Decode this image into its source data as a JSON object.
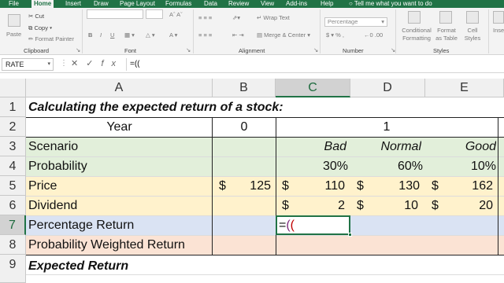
{
  "ribbon_tabs": [
    "File",
    "Home",
    "Insert",
    "Draw",
    "Page Layout",
    "Formulas",
    "Data",
    "Review",
    "View",
    "Add-ins",
    "Help"
  ],
  "active_tab": "Home",
  "tell_me": "Tell me what you want to do",
  "ribbon": {
    "paste": "Paste",
    "cut": "Cut",
    "copy": "Copy",
    "format_painter": "Format Painter",
    "clipboard": "Clipboard",
    "bold": "B",
    "italic": "I",
    "underline": "U",
    "font": "Font",
    "wrap_text": "Wrap Text",
    "merge_center": "Merge & Center",
    "alignment": "Alignment",
    "number_format": "Percentage",
    "number": "Number",
    "conditional_formatting": "Conditional Formatting",
    "format_as_table": "Format as Table",
    "cell_styles": "Cell Styles",
    "styles": "Styles",
    "insert": "Inse"
  },
  "formula_bar": {
    "name_box": "RATE",
    "cancel": "✕",
    "enter": "✓",
    "fx": "fx",
    "formula": "=(("
  },
  "columns": [
    "A",
    "B",
    "C",
    "D",
    "E"
  ],
  "selected_column": "C",
  "rows": [
    "1",
    "2",
    "3",
    "4",
    "5",
    "6",
    "7",
    "8",
    "9"
  ],
  "selected_row": "7",
  "sheet": {
    "title": "Calculating the expected return of a stock:",
    "year_label": "Year",
    "year_0": "0",
    "year_1": "1",
    "scenario_label": "Scenario",
    "scenario_bad": "Bad",
    "scenario_normal": "Normal",
    "scenario_good": "Good",
    "probability_label": "Probability",
    "prob_bad": "30%",
    "prob_normal": "60%",
    "prob_good": "10%",
    "price_label": "Price",
    "currency": "$",
    "price_0": "125",
    "price_bad": "110",
    "price_normal": "130",
    "price_good": "162",
    "dividend_label": "Dividend",
    "div_bad": "2",
    "div_normal": "10",
    "div_good": "20",
    "pct_return_label": "Percentage Return",
    "editing_eq": "=",
    "editing_p1": "(",
    "editing_p2": "(",
    "weighted_label": "Probability Weighted Return",
    "expected_label": "Expected Return"
  },
  "colors": {
    "excel_green": "#217346",
    "band_green": "#e2efda",
    "band_orange": "#fce4d6",
    "band_peach": "#fbe3d4",
    "band_blue": "#dae3f3",
    "band_cream": "#fff2cc"
  }
}
